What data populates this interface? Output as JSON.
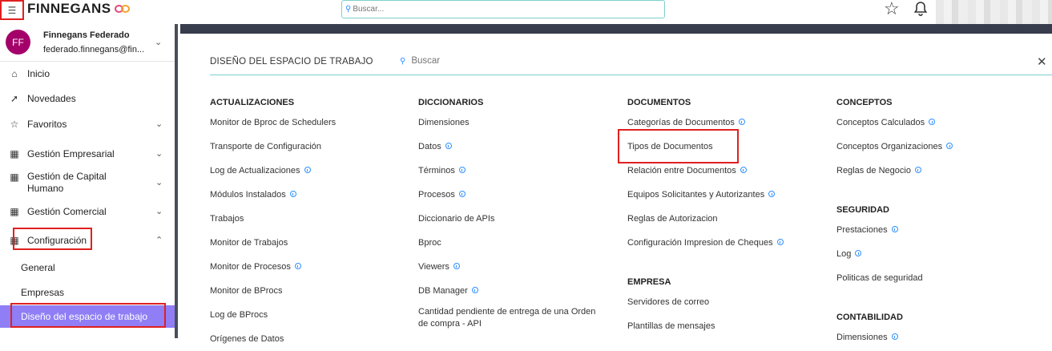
{
  "header": {
    "brand": "FINNEGANS",
    "search_placeholder": "Buscar..."
  },
  "user": {
    "initials": "FF",
    "name": "Finnegans Federado",
    "email": "federado.finnegans@fin..."
  },
  "sidebar": {
    "items": [
      {
        "label": "Inicio",
        "icon": "home-icon"
      },
      {
        "label": "Novedades",
        "icon": "pin-icon"
      },
      {
        "label": "Favoritos",
        "icon": "star-icon"
      },
      {
        "label": "Gestión Empresarial",
        "icon": "building-icon"
      },
      {
        "label": "Gestión de Capital Humano",
        "icon": "building-icon"
      },
      {
        "label": "Gestión Comercial",
        "icon": "building-icon"
      },
      {
        "label": "Configuración",
        "icon": "building-icon"
      }
    ],
    "subitems": [
      "General",
      "Empresas",
      "Diseño del espacio de trabajo"
    ]
  },
  "panel": {
    "title": "DISEÑO DEL ESPACIO DE TRABAJO",
    "search_placeholder": "Buscar"
  },
  "columns": [
    {
      "sections": [
        {
          "title": "ACTUALIZACIONES",
          "links": [
            {
              "label": "Monitor de Bproc de Schedulers",
              "info": false
            },
            {
              "label": "Transporte de Configuración",
              "info": false
            },
            {
              "label": "Log de Actualizaciones",
              "info": true
            },
            {
              "label": "Módulos Instalados",
              "info": true
            },
            {
              "label": "Trabajos",
              "info": false
            },
            {
              "label": "Monitor de Trabajos",
              "info": false
            },
            {
              "label": "Monitor de Procesos",
              "info": true
            },
            {
              "label": "Monitor de BProcs",
              "info": false
            },
            {
              "label": "Log de BProcs",
              "info": false
            },
            {
              "label": "Orígenes de Datos",
              "info": false
            }
          ]
        }
      ]
    },
    {
      "sections": [
        {
          "title": "DICCIONARIOS",
          "links": [
            {
              "label": "Dimensiones",
              "info": false
            },
            {
              "label": "Datos",
              "info": true
            },
            {
              "label": "Términos",
              "info": true
            },
            {
              "label": "Procesos",
              "info": true
            },
            {
              "label": "Diccionario de APIs",
              "info": false
            },
            {
              "label": "Bproc",
              "info": false
            },
            {
              "label": "Viewers",
              "info": true
            },
            {
              "label": "DB Manager",
              "info": true
            },
            {
              "label": "Cantidad pendiente de entrega de una Orden de compra - API",
              "info": false
            }
          ]
        }
      ]
    },
    {
      "sections": [
        {
          "title": "DOCUMENTOS",
          "links": [
            {
              "label": "Categorías de Documentos",
              "info": true
            },
            {
              "label": "Tipos de Documentos",
              "info": false
            },
            {
              "label": "Relación entre Documentos",
              "info": true
            },
            {
              "label": "Equipos Solicitantes y Autorizantes",
              "info": true
            },
            {
              "label": "Reglas de Autorizacion",
              "info": false
            },
            {
              "label": "Configuración Impresion de Cheques",
              "info": true
            }
          ]
        },
        {
          "title": "EMPRESA",
          "links": [
            {
              "label": "Servidores de correo",
              "info": false
            },
            {
              "label": "Plantillas de mensajes",
              "info": false
            }
          ]
        }
      ]
    },
    {
      "sections": [
        {
          "title": "CONCEPTOS",
          "links": [
            {
              "label": "Conceptos Calculados",
              "info": true
            },
            {
              "label": "Conceptos Organizaciones",
              "info": true
            },
            {
              "label": "Reglas de Negocio",
              "info": true
            }
          ]
        },
        {
          "title": "SEGURIDAD",
          "links": [
            {
              "label": "Prestaciones",
              "info": true
            },
            {
              "label": "Log",
              "info": true
            },
            {
              "label": "Politicas de seguridad",
              "info": false
            }
          ]
        },
        {
          "title": "CONTABILIDAD",
          "links": [
            {
              "label": "Dimensiones",
              "info": true
            }
          ]
        }
      ]
    }
  ]
}
